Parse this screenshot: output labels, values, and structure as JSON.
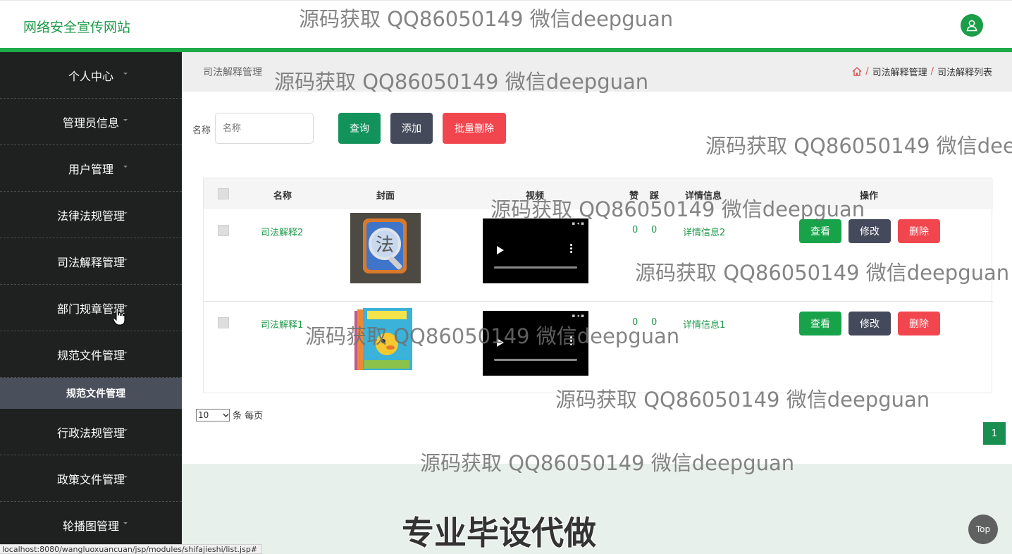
{
  "header": {
    "site_title": "网络安全宣传网站",
    "user_icon": "user-icon"
  },
  "sidebar": {
    "items": [
      {
        "label": "个人中心"
      },
      {
        "label": "管理员信息"
      },
      {
        "label": "用户管理"
      },
      {
        "label": "法律法规管理"
      },
      {
        "label": "司法解释管理"
      },
      {
        "label": "部门规章管理"
      },
      {
        "label": "规范文件管理"
      }
    ],
    "submenu": {
      "label": "规范文件管理"
    },
    "items_after": [
      {
        "label": "行政法规管理"
      },
      {
        "label": "政策文件管理"
      },
      {
        "label": "轮播图管理"
      }
    ]
  },
  "page": {
    "title": "司法解释管理",
    "breadcrumb": [
      "司法解释管理",
      "司法解释列表"
    ],
    "breadcrumb_sep": "/"
  },
  "search": {
    "label": "名称",
    "placeholder": "名称",
    "query": "查询",
    "add": "添加",
    "batch_delete": "批量删除"
  },
  "table": {
    "headers": {
      "name": "名称",
      "cover": "封面",
      "video": "视频",
      "likes": "赞",
      "dislikes": "踩",
      "detail": "详情信息",
      "actions": "操作"
    },
    "rows": [
      {
        "name": "司法解释2",
        "likes": "0",
        "dislikes": "0",
        "detail": "详情信息2",
        "view": "查看",
        "edit": "修改",
        "delete": "删除"
      },
      {
        "name": "司法解释1",
        "likes": "0",
        "dislikes": "0",
        "detail": "详情信息1",
        "view": "查看",
        "edit": "修改",
        "delete": "删除"
      }
    ]
  },
  "pagination": {
    "page_size": "10",
    "per_page_text": "条 每页",
    "current_page": "1"
  },
  "footer": {
    "promo": "专业毕设代做",
    "top": "Top"
  },
  "status_url": "localhost:8080/wangluoxuancuan/jsp/modules/shifajieshi/list.jsp#",
  "watermark": "源码获取 QQ86050149 微信deepguan",
  "colors": {
    "accent": "#1faa4b",
    "sidebar_bg": "#1f2120",
    "danger": "#f2464f",
    "dark_button": "#444a59"
  }
}
